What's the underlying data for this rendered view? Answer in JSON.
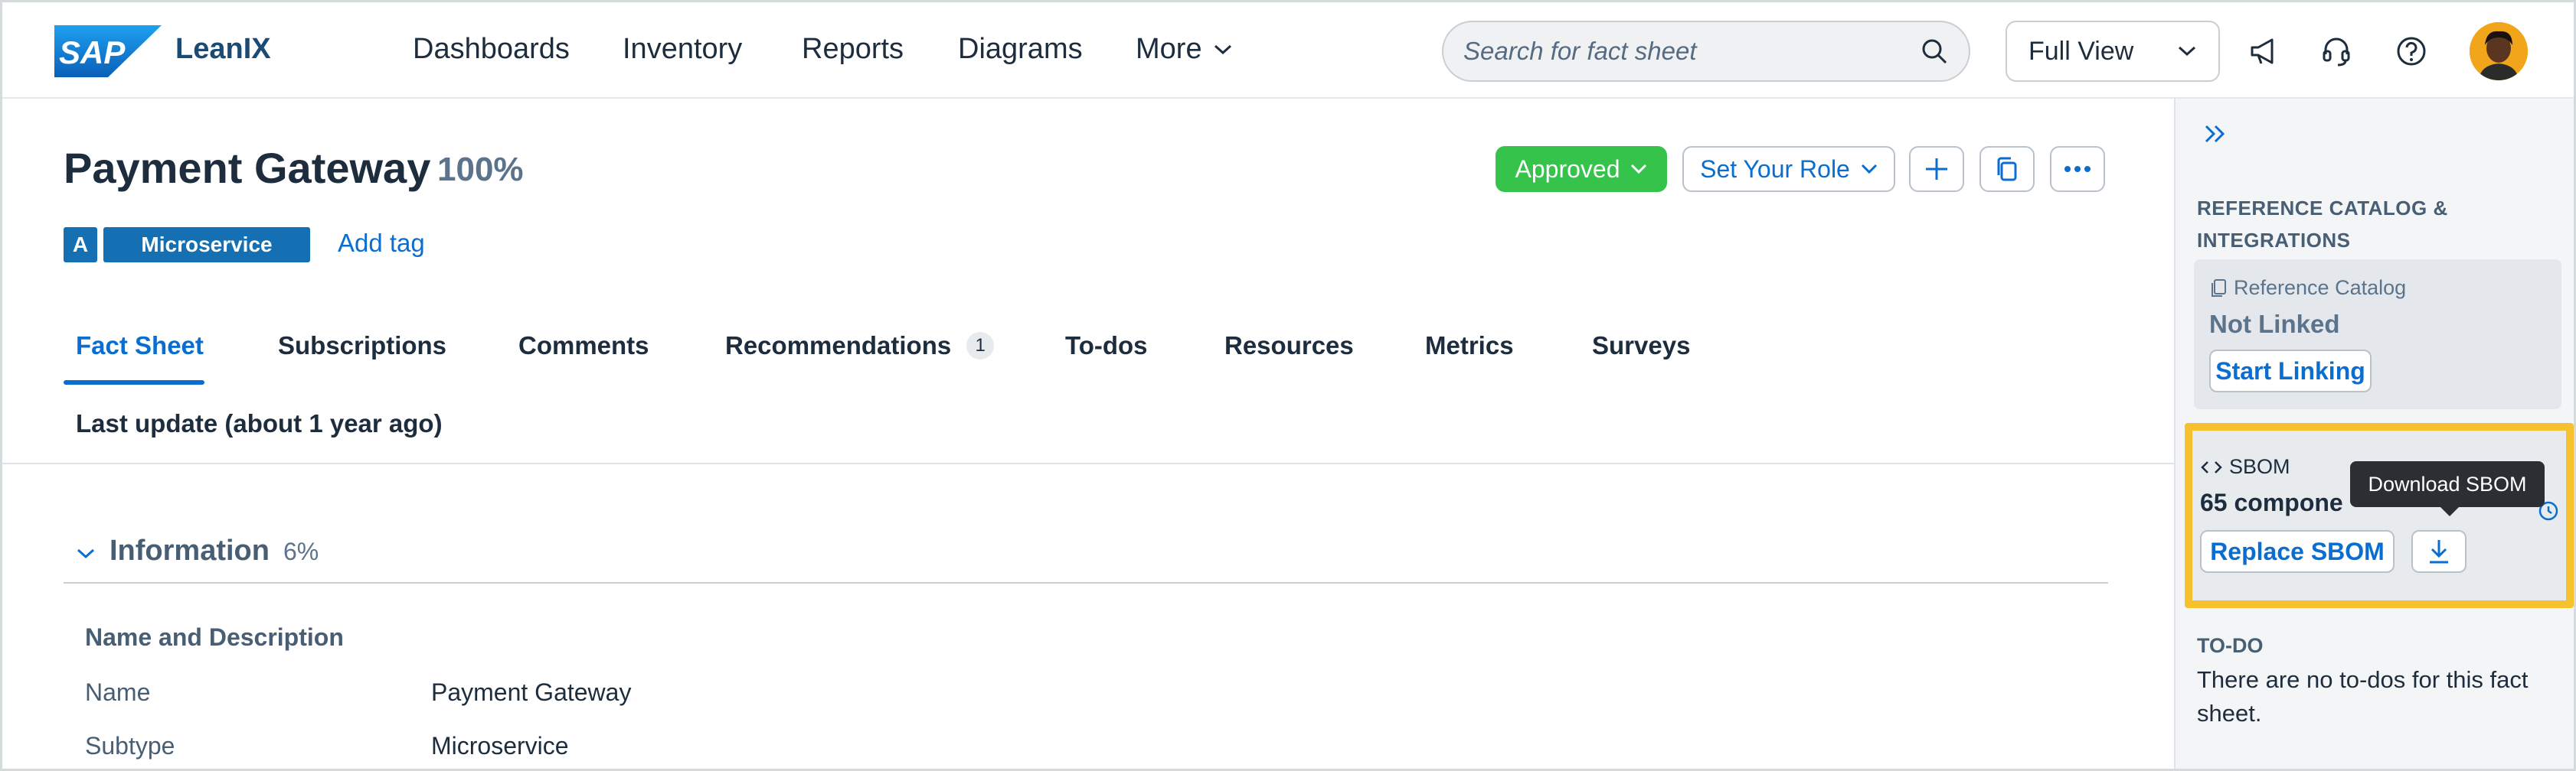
{
  "header": {
    "logo_text": "SAP",
    "brand": "LeanIX",
    "nav": [
      "Dashboards",
      "Inventory",
      "Reports",
      "Diagrams"
    ],
    "more_label": "More",
    "search_placeholder": "Search for fact sheet",
    "view_select": "Full View",
    "icons": [
      "megaphone-icon",
      "headset-icon",
      "help-icon"
    ],
    "avatar_color": "#f0a51a"
  },
  "factsheet": {
    "title": "Payment Gateway",
    "completion": "100%",
    "status": "Approved",
    "role_button": "Set Your Role",
    "tag_letter": "A",
    "tag": "Microservice",
    "add_tag": "Add tag",
    "tabs": [
      "Fact Sheet",
      "Subscriptions",
      "Comments",
      "Recommendations",
      "To-dos",
      "Resources",
      "Metrics",
      "Surveys"
    ],
    "recommendations_count": "1",
    "last_update": "Last update (about 1 year ago)"
  },
  "information": {
    "title": "Information",
    "completion": "6%",
    "subhead": "Name and Description",
    "fields": [
      {
        "label": "Name",
        "value": "Payment Gateway"
      },
      {
        "label": "Subtype",
        "value": "Microservice"
      }
    ]
  },
  "panel": {
    "heading": "REFERENCE CATALOG & INTEGRATIONS",
    "ref_catalog_label": "Reference Catalog",
    "ref_catalog_status": "Not Linked",
    "start_linking": "Start Linking",
    "sbom_label": "SBOM",
    "sbom_count": "65 compone",
    "replace_sbom": "Replace SBOM",
    "download_tooltip": "Download SBOM",
    "todo_heading": "TO-DO",
    "todo_text": "There are no to-dos for this fact sheet."
  },
  "colors": {
    "accent": "#0a6ed1",
    "approved": "#36c34b",
    "tag": "#146fb3",
    "highlight": "#f6c12c"
  }
}
